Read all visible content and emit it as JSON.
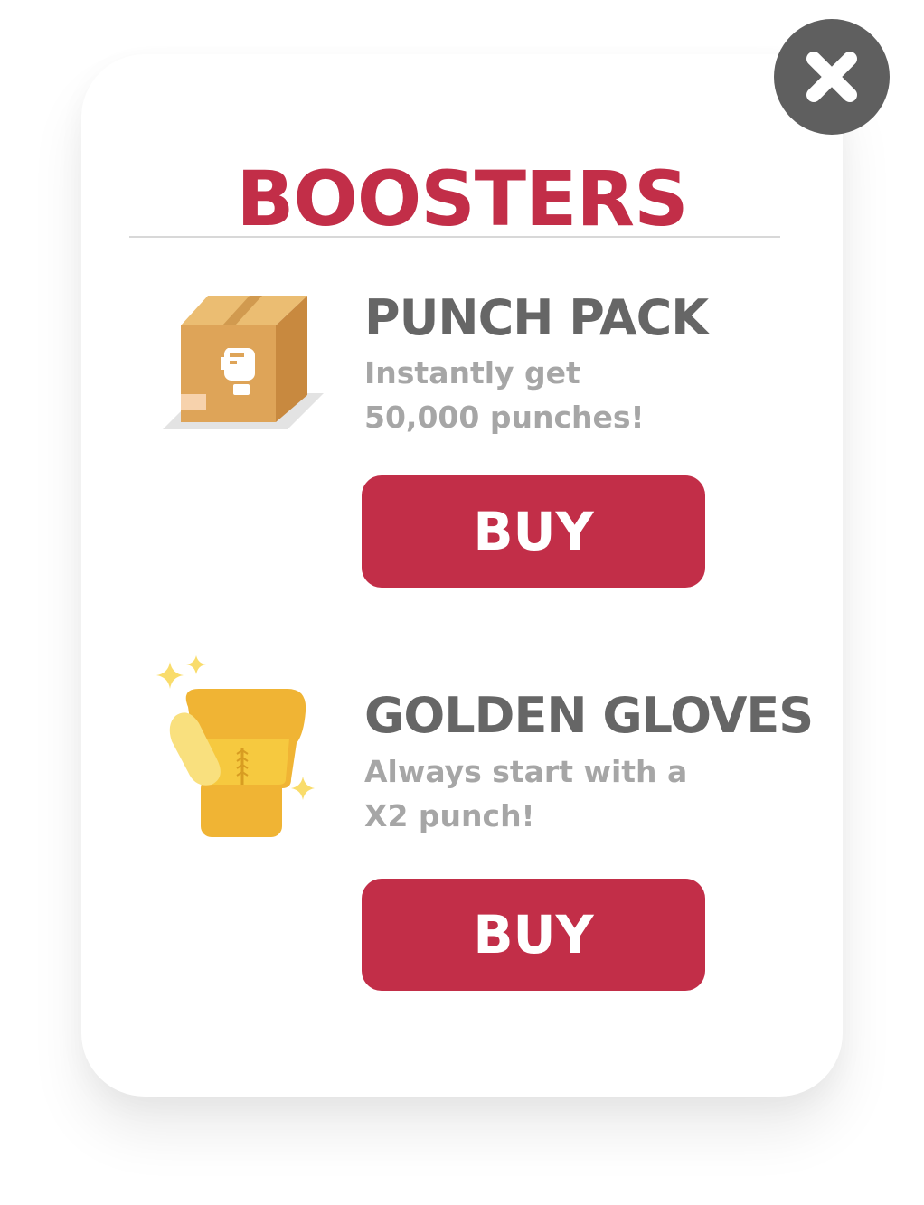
{
  "modal": {
    "title": "BOOSTERS",
    "close_icon": "close-icon"
  },
  "boosters": [
    {
      "icon": "box-icon",
      "title": "PUNCH PACK",
      "description": "Instantly get 50,000 punches!",
      "buy_label": "BUY"
    },
    {
      "icon": "golden-glove-icon",
      "title": "GOLDEN GLOVES",
      "description": "Always start with a X2 punch!",
      "buy_label": "BUY"
    }
  ],
  "colors": {
    "accent": "#c22e48",
    "close_button": "#5f5f5f",
    "title_text": "#666666",
    "desc_text": "#a6a6a6",
    "gold": "#f0b434"
  }
}
